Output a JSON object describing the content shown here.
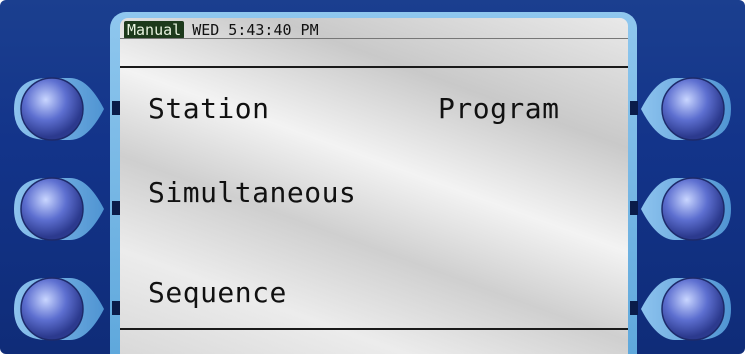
{
  "status_bar": {
    "mode": "Manual",
    "datetime": "WED 5:43:40 PM"
  },
  "menu": {
    "station": "Station",
    "program": "Program",
    "simultaneous": "Simultaneous",
    "sequence": "Sequence"
  },
  "colors": {
    "bezel": "#13348a",
    "screen_frame": "#6fb3e4",
    "mode_badge_bg": "#1d3a1c"
  }
}
